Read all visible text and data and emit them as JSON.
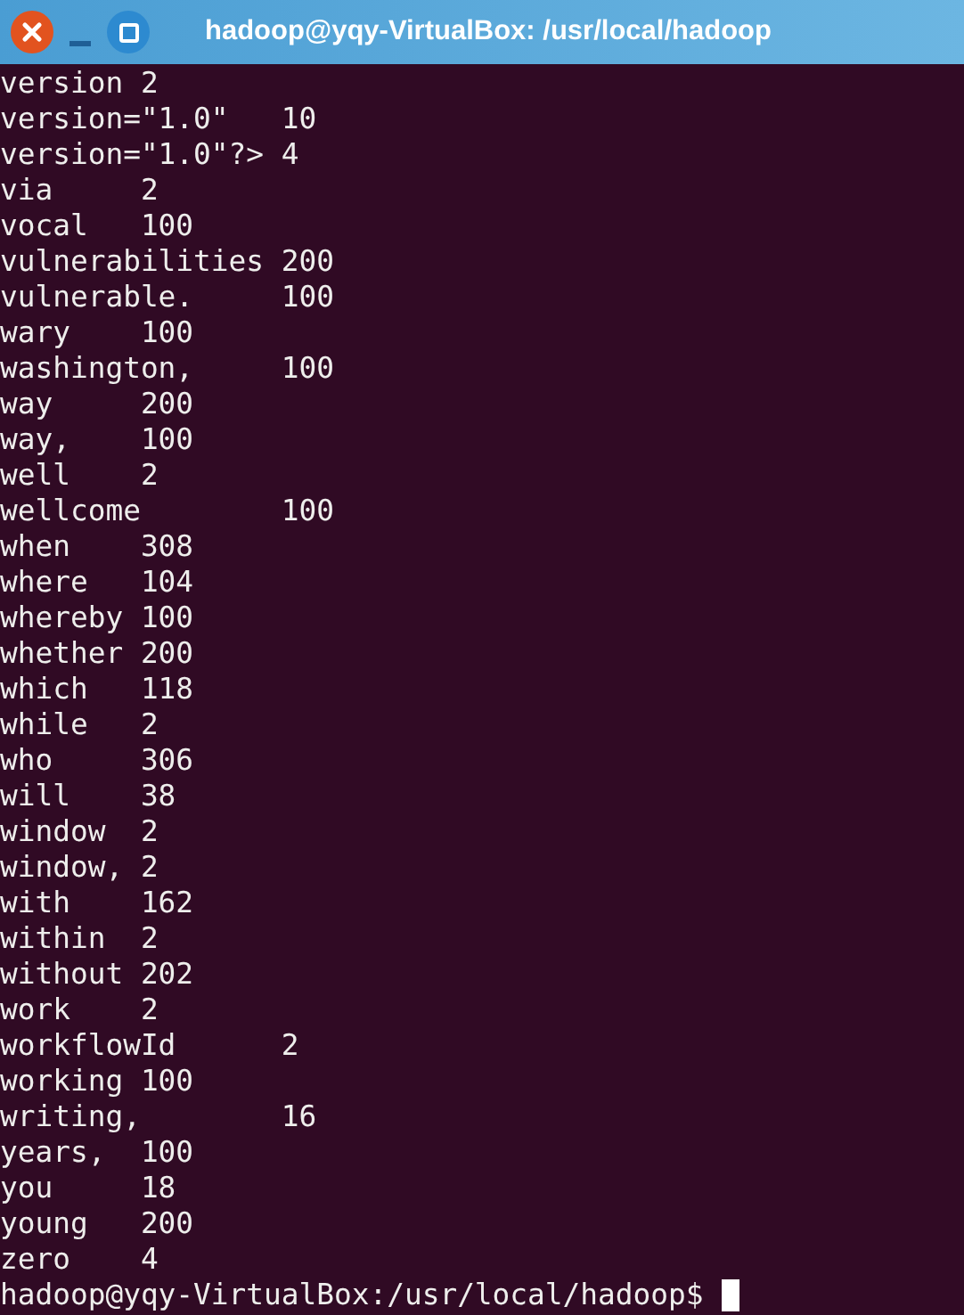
{
  "window": {
    "title": "hadoop@yqy-VirtualBox: /usr/local/hadoop"
  },
  "terminal": {
    "lines": [
      {
        "word": "version",
        "count": "2"
      },
      {
        "word": "version=\"1.0\"",
        "count": "10"
      },
      {
        "word": "version=\"1.0\"?>",
        "count": "4"
      },
      {
        "word": "via",
        "count": "2"
      },
      {
        "word": "vocal",
        "count": "100"
      },
      {
        "word": "vulnerabilities",
        "count": "200"
      },
      {
        "word": "vulnerable.",
        "count": "100"
      },
      {
        "word": "wary",
        "count": "100"
      },
      {
        "word": "washington,",
        "count": "100"
      },
      {
        "word": "way",
        "count": "200"
      },
      {
        "word": "way,",
        "count": "100"
      },
      {
        "word": "well",
        "count": "2"
      },
      {
        "word": "wellcome",
        "count": "100"
      },
      {
        "word": "when",
        "count": "308"
      },
      {
        "word": "where",
        "count": "104"
      },
      {
        "word": "whereby",
        "count": "100"
      },
      {
        "word": "whether",
        "count": "200"
      },
      {
        "word": "which",
        "count": "118"
      },
      {
        "word": "while",
        "count": "2"
      },
      {
        "word": "who",
        "count": "306"
      },
      {
        "word": "will",
        "count": "38"
      },
      {
        "word": "window",
        "count": "2"
      },
      {
        "word": "window,",
        "count": "2"
      },
      {
        "word": "with",
        "count": "162"
      },
      {
        "word": "within",
        "count": "2"
      },
      {
        "word": "without",
        "count": "202"
      },
      {
        "word": "work",
        "count": "2"
      },
      {
        "word": "workflowId",
        "count": "2"
      },
      {
        "word": "working",
        "count": "100"
      },
      {
        "word": "writing,",
        "count": "16"
      },
      {
        "word": "years,",
        "count": "100"
      },
      {
        "word": "you",
        "count": "18"
      },
      {
        "word": "young",
        "count": "200"
      },
      {
        "word": "zero",
        "count": "4"
      }
    ],
    "prompt": "hadoop@yqy-VirtualBox:/usr/local/hadoop$"
  }
}
